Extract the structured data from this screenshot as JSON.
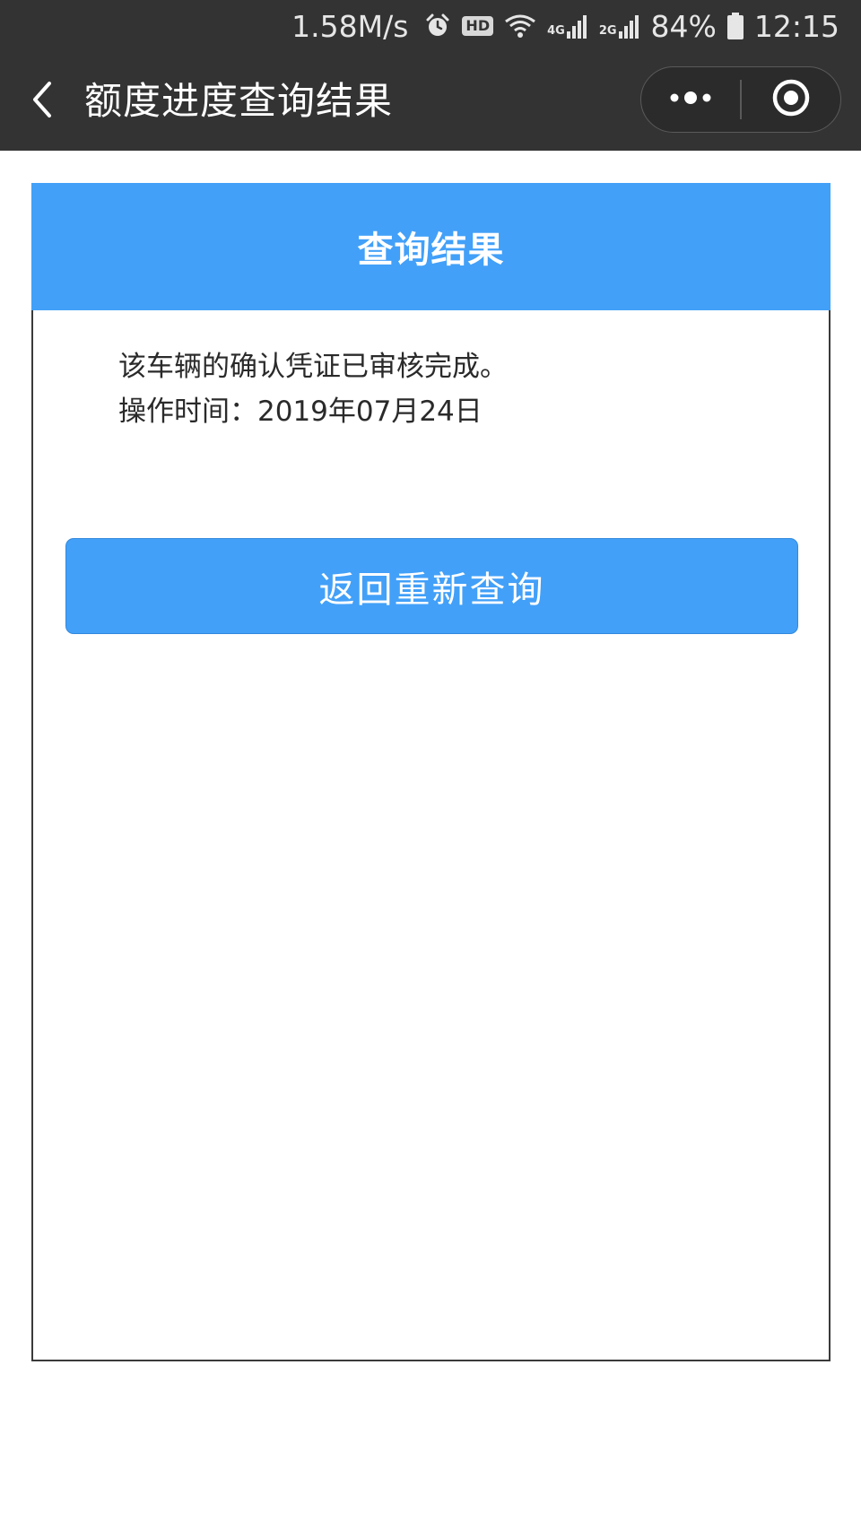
{
  "status_bar": {
    "net_speed": "1.58M/s",
    "hd_badge": "HD",
    "net_4g": "4G",
    "net_2g": "2G",
    "battery_percent": "84%",
    "time": "12:15",
    "icons": [
      "alarm-icon",
      "hd-badge",
      "wifi-icon",
      "signal-icon",
      "signal-icon",
      "battery-icon"
    ]
  },
  "navbar": {
    "back_icon": "chevron-left-icon",
    "title": "额度进度查询结果",
    "more_icon": "more-dots-icon",
    "close_icon": "target-circle-icon"
  },
  "card": {
    "title": "查询结果",
    "lines": [
      "该车辆的确认凭证已审核完成。",
      "操作时间：2019年07月24日"
    ],
    "requery_button_label": "返回重新查询"
  },
  "colors": {
    "topbar": "#333333",
    "accent": "#42a0f8",
    "card_border": "#3a3a3a",
    "text": "#2a2a2a"
  }
}
